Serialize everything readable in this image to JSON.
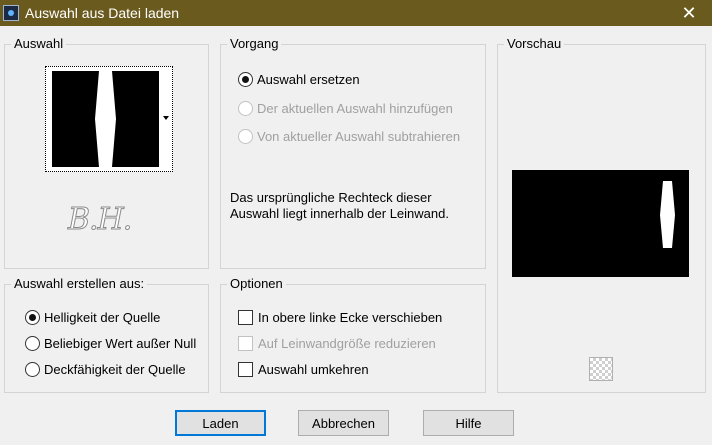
{
  "window": {
    "title": "Auswahl aus Datei laden",
    "close_symbol": "✕",
    "app_icon": "psp-app-icon"
  },
  "auswahl": {
    "label": "Auswahl",
    "signature": "B.H."
  },
  "vorgang": {
    "label": "Vorgang",
    "options": [
      {
        "label": "Auswahl ersetzen",
        "checked": true,
        "enabled": true
      },
      {
        "label": "Der aktuellen Auswahl hinzufügen",
        "checked": false,
        "enabled": false
      },
      {
        "label": "Von aktueller Auswahl subtrahieren",
        "checked": false,
        "enabled": false
      }
    ],
    "info": "Das ursprüngliche Rechteck dieser Auswahl liegt innerhalb der Leinwand."
  },
  "vorschau": {
    "label": "Vorschau",
    "transparency_icon": "checkerboard-icon"
  },
  "erstellen": {
    "label": "Auswahl erstellen aus:",
    "options": [
      {
        "label": "Helligkeit der Quelle",
        "checked": true
      },
      {
        "label": "Beliebiger Wert außer Null",
        "checked": false
      },
      {
        "label": "Deckfähigkeit der Quelle",
        "checked": false
      }
    ]
  },
  "optionen": {
    "label": "Optionen",
    "checks": [
      {
        "label": "In obere linke Ecke verschieben",
        "checked": false,
        "enabled": true
      },
      {
        "label": "Auf Leinwandgröße reduzieren",
        "checked": false,
        "enabled": false
      },
      {
        "label": "Auswahl umkehren",
        "checked": false,
        "enabled": true
      }
    ]
  },
  "buttons": {
    "laden": "Laden",
    "abbrechen": "Abbrechen",
    "hilfe": "Hilfe"
  },
  "colors": {
    "titlebar": "#6b5a1e",
    "focus": "#0078d7"
  }
}
